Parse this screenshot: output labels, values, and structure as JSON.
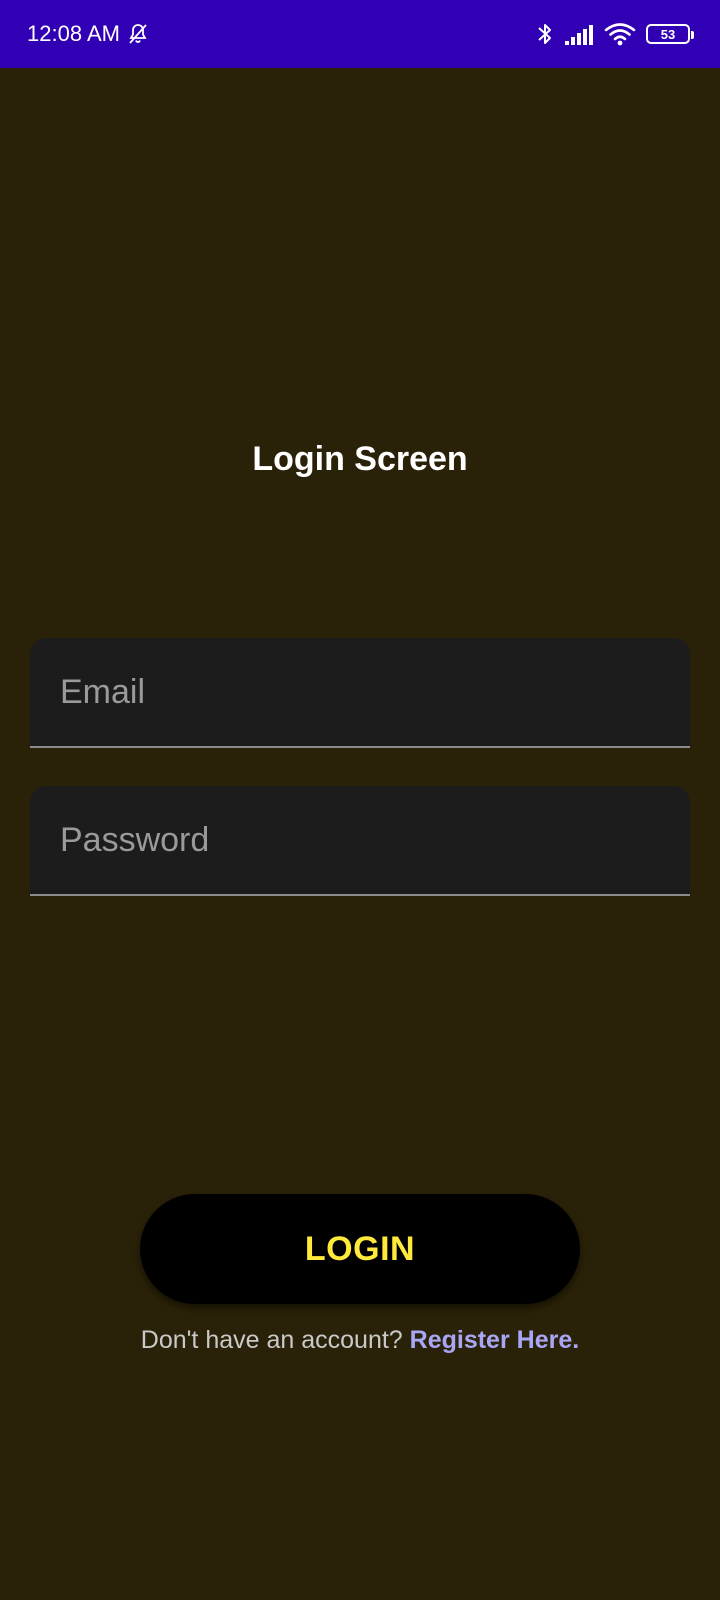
{
  "status_bar": {
    "time": "12:08 AM",
    "battery": "53",
    "icons": [
      "mute-notifications-icon",
      "bluetooth-icon",
      "signal-icon",
      "wifi-icon",
      "battery-icon"
    ],
    "background_color": "#3200b4"
  },
  "title": "Login Screen",
  "email": {
    "placeholder": "Email",
    "value": ""
  },
  "password": {
    "placeholder": "Password",
    "value": ""
  },
  "login_button": {
    "label": "LOGIN",
    "text_color": "#ffe93a"
  },
  "register": {
    "prompt": "Don't have an account?",
    "link_label": "Register Here.",
    "link_color": "#a9a6f5"
  },
  "colors": {
    "background": "#2a2208",
    "field_background": "#1c1c1c"
  }
}
